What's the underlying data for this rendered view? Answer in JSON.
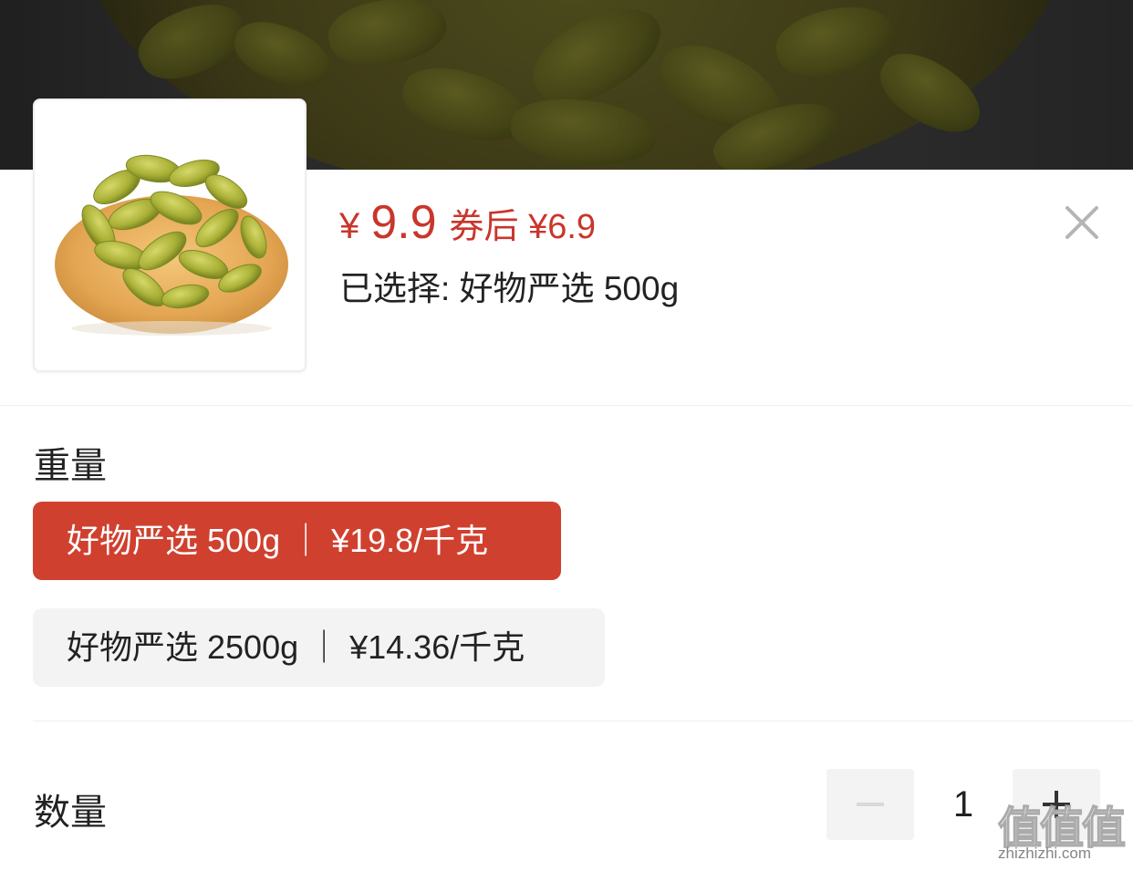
{
  "product": {
    "price_symbol": "¥",
    "price_value": "9.9",
    "coupon_price": "券后 ¥6.9",
    "selected_text": "已选择: 好物严选 500g",
    "thumbnail_icon": "raisins-product-image"
  },
  "close": {
    "icon": "close-icon"
  },
  "weight": {
    "label": "重量",
    "options": [
      {
        "label": "好物严选 500g ｜ ¥19.8/千克",
        "selected": true
      },
      {
        "label": "好物严选 2500g ｜ ¥14.36/千克",
        "selected": false
      }
    ]
  },
  "quantity": {
    "label": "数量",
    "value": "1",
    "minus_icon": "minus-icon",
    "plus_icon": "plus-icon"
  },
  "watermark": {
    "chars": "值值值",
    "url": "zhizhizhi.com"
  },
  "colors": {
    "accent": "#d0402f",
    "price": "#c9362b",
    "option_bg": "#f3f3f3",
    "text": "#222222"
  }
}
